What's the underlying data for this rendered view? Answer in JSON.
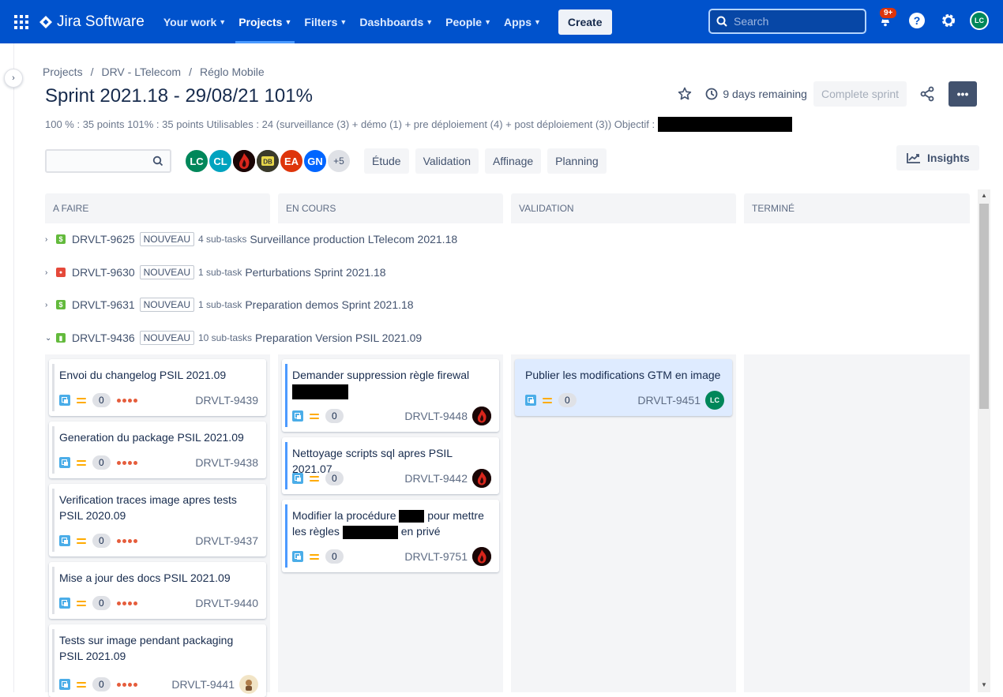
{
  "nav": {
    "product": "Jira Software",
    "items": [
      {
        "label": "Your work",
        "active": false
      },
      {
        "label": "Projects",
        "active": true
      },
      {
        "label": "Filters",
        "active": false
      },
      {
        "label": "Dashboards",
        "active": false
      },
      {
        "label": "People",
        "active": false
      },
      {
        "label": "Apps",
        "active": false
      }
    ],
    "create_label": "Create",
    "search_placeholder": "Search",
    "notification_count": "9+",
    "user_initials": "LC"
  },
  "breadcrumb": [
    "Projects",
    "DRV - LTelecom",
    "Réglo Mobile"
  ],
  "sprint": {
    "title": "Sprint 2021.18 - 29/08/21 101%",
    "days_remaining": "9 days remaining",
    "complete_label": "Complete sprint",
    "goal": "100 % : 35 points 101% : 35 points Utilisables : 24 (surveillance (3) + démo (1) + pre déploiement (4) + post déploiement (3)) Objectif :"
  },
  "filters": {
    "avatars": [
      {
        "initials": "LC",
        "color": "#00875a"
      },
      {
        "initials": "CL",
        "color": "#00a3bf"
      },
      {
        "initials": "",
        "color": "#bf2600",
        "icon": "flame-avatar"
      },
      {
        "initials": "DB",
        "color": "#2f2f2f",
        "icon": "db-avatar"
      },
      {
        "initials": "EA",
        "color": "#de350b"
      },
      {
        "initials": "GN",
        "color": "#0065ff"
      },
      {
        "initials": "+5",
        "color": "#dfe1e6"
      }
    ],
    "quick": [
      "Étude",
      "Validation",
      "Affinage",
      "Planning"
    ],
    "insights_label": "Insights"
  },
  "columns": [
    "A FAIRE",
    "EN COURS",
    "VALIDATION",
    "TERMINÉ"
  ],
  "swimlanes": [
    {
      "key": "DRVLT-9625",
      "status": "NOUVEAU",
      "subtasks": "4 sub-tasks",
      "summary": "Surveillance production LTelecom 2021.18",
      "type_color": "#63ba3c",
      "type_glyph": "$",
      "expanded": false
    },
    {
      "key": "DRVLT-9630",
      "status": "NOUVEAU",
      "subtasks": "1 sub-task",
      "summary": "Perturbations Sprint 2021.18",
      "type_color": "#e5493a",
      "type_glyph": "●",
      "expanded": false
    },
    {
      "key": "DRVLT-9631",
      "status": "NOUVEAU",
      "subtasks": "1 sub-task",
      "summary": "Preparation demos Sprint 2021.18",
      "type_color": "#63ba3c",
      "type_glyph": "$",
      "expanded": false
    },
    {
      "key": "DRVLT-9436",
      "status": "NOUVEAU",
      "subtasks": "10 sub-tasks",
      "summary": "Preparation Version PSIL 2021.09",
      "type_color": "#63ba3c",
      "type_glyph": "▮",
      "expanded": true
    }
  ],
  "cards": {
    "todo": [
      {
        "title": "Envoi du changelog PSIL 2021.09",
        "key": "DRVLT-9439",
        "points": "0"
      },
      {
        "title": "Generation du package PSIL 2021.09",
        "key": "DRVLT-9438",
        "points": "0"
      },
      {
        "title": "Verification traces image apres tests PSIL 2020.09",
        "key": "DRVLT-9437",
        "points": "0"
      },
      {
        "title": "Mise a jour des docs PSIL 2021.09",
        "key": "DRVLT-9440",
        "points": "0"
      },
      {
        "title": "Tests sur image pendant packaging PSIL 2021.09",
        "key": "DRVLT-9441",
        "points": "0"
      }
    ],
    "inprogress": [
      {
        "title": "Demander suppression règle firewal",
        "key": "DRVLT-9448",
        "points": "0"
      },
      {
        "title": "Nettoyage scripts sql apres PSIL 2021.07",
        "key": "DRVLT-9442",
        "points": "0"
      },
      {
        "title_a": "Modifier la procédure",
        "title_b": "pour mettre les règles",
        "title_c": "en privé",
        "key": "DRVLT-9751",
        "points": "0"
      }
    ],
    "validation": [
      {
        "title": "Publier les modifications GTM en image",
        "key": "DRVLT-9451",
        "points": "0",
        "assignee": "LC"
      }
    ]
  }
}
